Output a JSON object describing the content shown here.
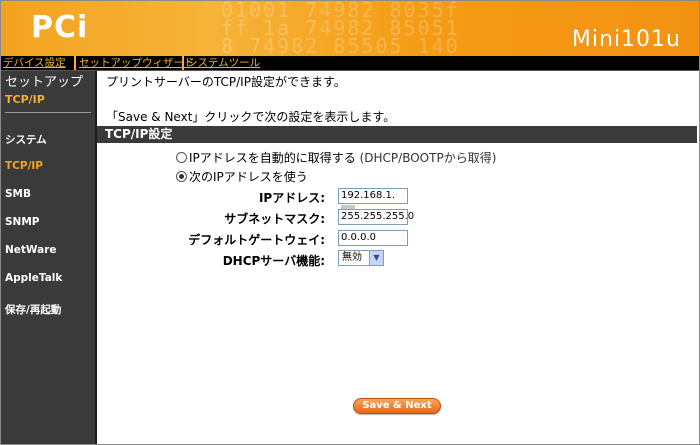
{
  "header": {
    "logo_text": "PCi",
    "model": "Mini101u",
    "pattern_lines": [
      "01001 74982 8035f",
      "ff 1a 74982 85051",
      "8 74982 85505 140"
    ]
  },
  "topmenu": {
    "items": [
      "デバイス設定",
      "セットアップウィザード",
      "システムツール"
    ]
  },
  "sidebar": {
    "title": "セットアップ",
    "subtitle": "TCP/IP",
    "items": [
      {
        "label": "システム",
        "active": false
      },
      {
        "label": "TCP/IP",
        "active": true
      },
      {
        "label": "SMB",
        "active": false
      },
      {
        "label": "SNMP",
        "active": false
      },
      {
        "label": "NetWare",
        "active": false
      },
      {
        "label": "AppleTalk",
        "active": false
      },
      {
        "label": "保存/再起動",
        "active": false
      }
    ]
  },
  "main": {
    "intro_line1": "プリントサーバーのTCP/IP設定ができます。",
    "intro_line2": "「Save & Next」クリックで次の設定を表示します。",
    "section_title": "TCP/IP設定",
    "radio_auto_label": "IPアドレスを自動的に取得する",
    "radio_auto_hint": "(DHCP/BOOTPから取得)",
    "radio_manual_label": "次のIPアドレスを使う",
    "selected_mode": "manual",
    "ip_label": "IPアドレス:",
    "ip_value": "192.168.1.",
    "subnet_label": "サブネットマスク:",
    "subnet_value": "255.255.255.0",
    "gateway_label": "デフォルトゲートウェイ:",
    "gateway_value": "0.0.0.0",
    "dhcp_label": "DHCPサーバ機能:",
    "dhcp_value": "無効",
    "save_button": "Save & Next"
  },
  "colors": {
    "accent": "#f6a41e",
    "sidebar_bg": "#3a3a3a",
    "button": "#e8661a"
  }
}
